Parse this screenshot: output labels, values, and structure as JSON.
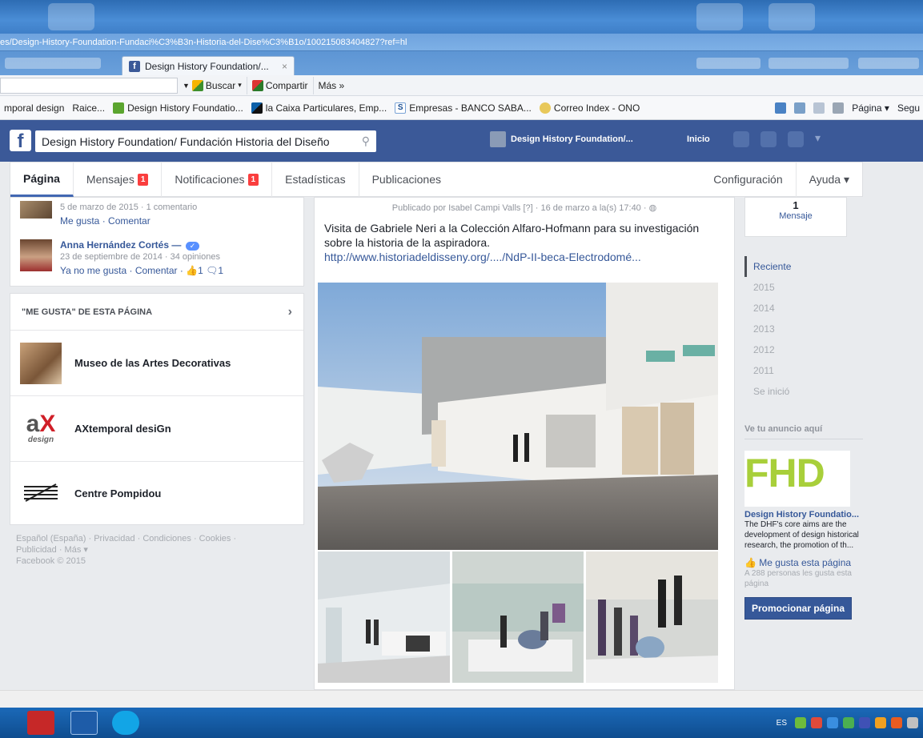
{
  "browser": {
    "url": "es/Design-History-Foundation-Fundaci%C3%B3n-Historia-del-Dise%C3%B1o/100215083404827?ref=hl",
    "tab_title": "Design History Foundation/...",
    "tab_close": "×",
    "toolbar": {
      "search_label": "Buscar",
      "share_label": "Compartir",
      "more_label": "Más »"
    },
    "favorites": [
      "mporal design",
      "Raice...",
      "Design History Foundatio...",
      "la Caixa  Particulares, Emp...",
      "Empresas - BANCO SABA...",
      "Correo Index - ONO"
    ],
    "page_menu": "Página ▾",
    "safety_menu": "Segu"
  },
  "fb": {
    "logo": "f",
    "search_value": "Design History Foundation/ Fundación Historia del Diseño",
    "user_name": "Design History Foundation/...",
    "home": "Inicio"
  },
  "page_nav": {
    "items": [
      {
        "label": "Página"
      },
      {
        "label": "Mensajes",
        "badge": "1"
      },
      {
        "label": "Notificaciones",
        "badge": "1"
      },
      {
        "label": "Estadísticas"
      },
      {
        "label": "Publicaciones"
      }
    ],
    "settings": "Configuración",
    "help": "Ayuda ▾"
  },
  "left": {
    "comment1": {
      "meta": "5 de marzo de 2015 · 1 comentario",
      "actions": "Me gusta · Comentar"
    },
    "comment2": {
      "name": "Anna Hernández Cortés —",
      "meta": "23 de septiembre de 2014 · 34 opiniones",
      "actions": "Ya no me gusta · Comentar · ",
      "likes": "1",
      "comments": "1"
    },
    "likes_header": "\"ME GUSTA\" DE ESTA PÁGINA",
    "liked_pages": [
      {
        "name": "Museo de las Artes Decorativas"
      },
      {
        "name": "AXtemporal desiGn"
      },
      {
        "name": "Centre Pompidou"
      }
    ],
    "footer": {
      "line1": "Español (España) · Privacidad · Condiciones · Cookies ·",
      "line2": "Publicidad · Más ▾",
      "line3": "Facebook © 2015"
    }
  },
  "post": {
    "meta": "Publicado por Isabel Campi Valls [?] · 16 de marzo a la(s) 17:40 · ",
    "text": "Visita de Gabriele Neri a la Colección Alfaro-Hofmann para su investigación sobre la historia de la aspiradora.",
    "link": "http://www.historiadeldisseny.org/..../NdP-II-beca-Electrodomé..."
  },
  "right": {
    "messages_count": "1",
    "messages_label": "Mensaje",
    "timeline": [
      "Reciente",
      "2015",
      "2014",
      "2013",
      "2012",
      "2011",
      "Se inició"
    ],
    "ads_title": "Ve tu anuncio aquí",
    "ad_logo": "FHD",
    "ad_title": "Design History Foundatio...",
    "ad_body": "The DHF's core aims are the development of design historical research, the promotion of th...",
    "ad_like": "Me gusta esta página",
    "ad_count": "A 288 personas les gusta esta página",
    "promote": "Promocionar página"
  },
  "taskbar": {
    "lang": "ES"
  }
}
